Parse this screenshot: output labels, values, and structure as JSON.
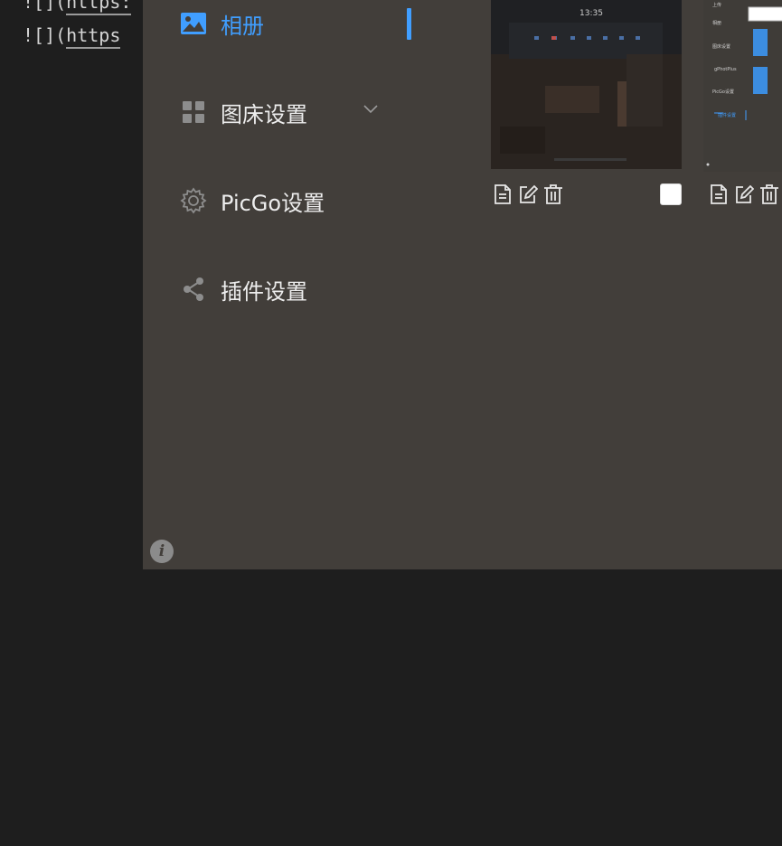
{
  "editor": {
    "lines": [
      {
        "prefix": "![](",
        "url": "https:"
      },
      {
        "prefix": "![](",
        "url": "https"
      }
    ]
  },
  "sidebar": {
    "items": [
      {
        "label": "相册",
        "icon": "image-icon",
        "active": true
      },
      {
        "label": "图床设置",
        "icon": "grid-icon",
        "active": false
      },
      {
        "label": "PicGo设置",
        "icon": "gear-icon",
        "active": false
      },
      {
        "label": "插件设置",
        "icon": "share-icon",
        "active": false
      }
    ]
  },
  "gallery": {
    "thumb1": {
      "clock": "13:35"
    },
    "thumb2": {
      "lines": [
        "上传",
        "相册",
        "图床设置",
        "gPhotPlus",
        "PicGo设置",
        "插件设置"
      ]
    }
  },
  "colors": {
    "accent": "#409eff",
    "window_bg": "#423e3a",
    "editor_bg": "#1e1e1e"
  }
}
